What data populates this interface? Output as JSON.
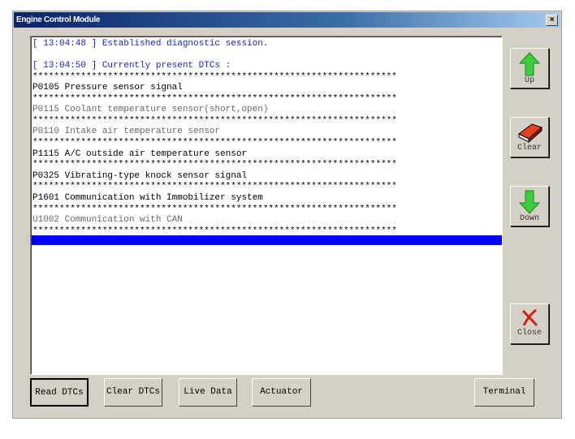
{
  "window": {
    "title": "Engine Control Module",
    "close_glyph": "×"
  },
  "log": {
    "session": "[ 13:04:48 ] Established diagnostic session.",
    "header": "[ 13:04:50 ] Currently present DTCs :",
    "separator": "********************************************************************",
    "dtcs": [
      {
        "text": "P0105 Pressure sensor signal",
        "color": "black"
      },
      {
        "text": "P0115 Coolant temperature sensor(short,open)",
        "color": "gray"
      },
      {
        "text": "P0110 Intake air temperature sensor",
        "color": "gray"
      },
      {
        "text": "P1115 A/C outside air temperature sensor",
        "color": "black"
      },
      {
        "text": "P0325 Vibrating-type knock sensor signal",
        "color": "black"
      },
      {
        "text": "P1601 Communication with Immobilizer system",
        "color": "black"
      },
      {
        "text": "U1002 Communication with CAN",
        "color": "gray"
      }
    ]
  },
  "side": {
    "up": "Up",
    "clear": "Clear",
    "down": "Down",
    "close": "Close"
  },
  "bottom": {
    "read": "Read DTCs",
    "clear": "Clear DTCs",
    "live": "Live Data",
    "actuator": "Actuator",
    "terminal": "Terminal"
  }
}
